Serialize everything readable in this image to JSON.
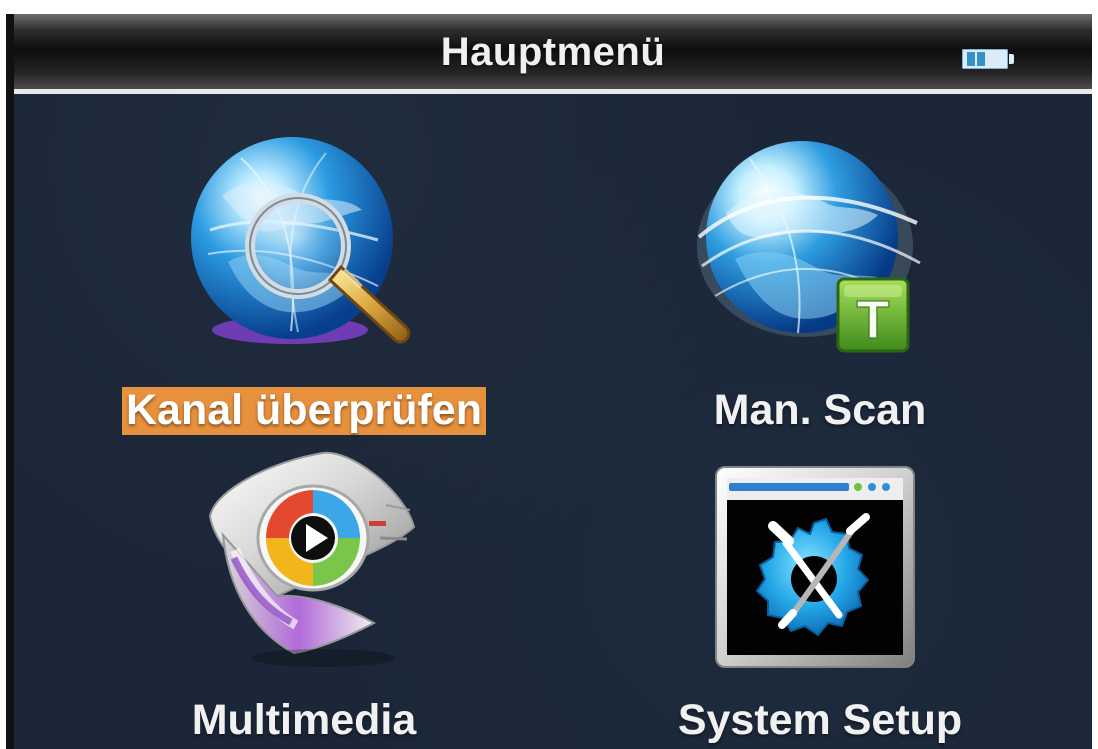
{
  "screen": {
    "title": "Hauptmenü",
    "battery_icon": "battery-icon"
  },
  "menu": {
    "items": [
      {
        "label": "Kanal überprüfen",
        "icon": "globe-search-icon",
        "selected": true
      },
      {
        "label": "Man. Scan",
        "icon": "globe-t-scan-icon",
        "selected": false
      },
      {
        "label": "Multimedia",
        "icon": "multimedia-player-icon",
        "selected": false
      },
      {
        "label": "System Setup",
        "icon": "system-setup-icon",
        "selected": false
      }
    ]
  },
  "colors": {
    "background": "#1b2738",
    "selected_label": "#e8913d",
    "title_text": "#f0f0f0"
  }
}
